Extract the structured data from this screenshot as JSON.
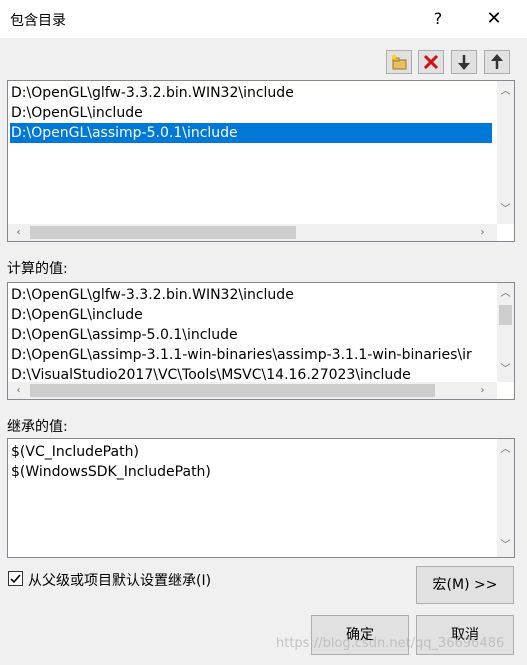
{
  "window": {
    "title": "包含目录",
    "help": "?",
    "close": "✕"
  },
  "toolbar": {
    "new_line": "new-line-icon",
    "delete": "delete-icon",
    "move_down": "arrow-down-icon",
    "move_up": "arrow-up-icon"
  },
  "include_list": {
    "items": [
      "D:\\OpenGL\\glfw-3.3.2.bin.WIN32\\include",
      "D:\\OpenGL\\include",
      "D:\\OpenGL\\assimp-5.0.1\\include"
    ],
    "selected_index": 2
  },
  "computed": {
    "label": "计算的值:",
    "items": [
      "D:\\OpenGL\\glfw-3.3.2.bin.WIN32\\include",
      "D:\\OpenGL\\include",
      "D:\\OpenGL\\assimp-5.0.1\\include",
      "D:\\OpenGL\\assimp-3.1.1-win-binaries\\assimp-3.1.1-win-binaries\\ir",
      "D:\\VisualStudio2017\\VC\\Tools\\MSVC\\14.16.27023\\include"
    ]
  },
  "inherited": {
    "label": "继承的值:",
    "items": [
      "$(VC_IncludePath)",
      "$(WindowsSDK_IncludePath)"
    ]
  },
  "inherit_checkbox": {
    "label": "从父级或项目默认设置继承(I)",
    "checked": true
  },
  "buttons": {
    "macro": "宏(M) >>",
    "ok": "确定",
    "cancel": "取消"
  },
  "watermark": "https://blog.csdn.net/qq_36696486"
}
